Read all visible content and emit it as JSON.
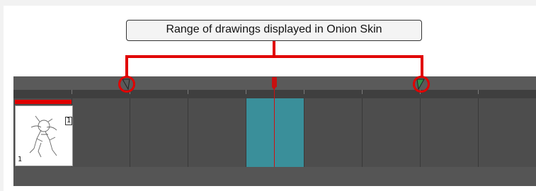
{
  "callout": {
    "text": "Range of drawings displayed in Onion Skin"
  },
  "timeline": {
    "drawing_thumbnail": {
      "frame_number": "1",
      "exposure_label": "1"
    }
  },
  "colors": {
    "annotation_red": "#e10000",
    "current_frame_highlight": "#3a8f9a",
    "timeline_background": "#4a4a4a"
  },
  "icons": {
    "onion_skin_start": "onion-skin-start-marker-icon",
    "onion_skin_end": "onion-skin-end-marker-icon",
    "playhead": "playhead-icon"
  }
}
